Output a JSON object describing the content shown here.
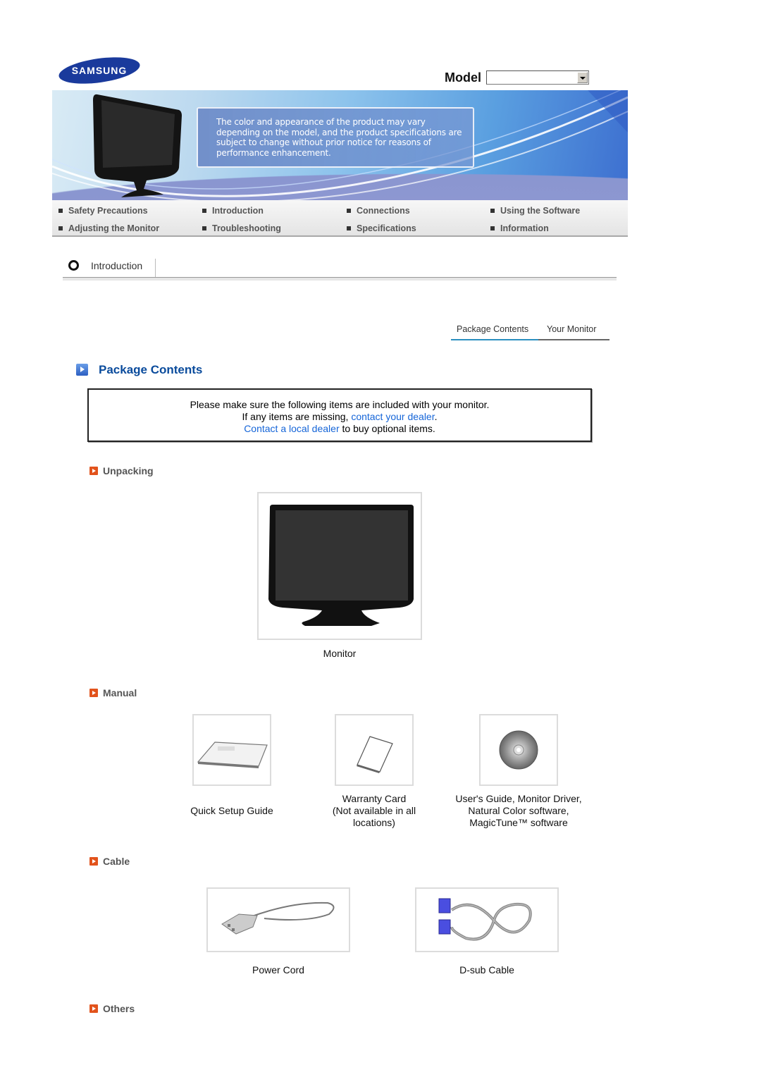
{
  "header": {
    "brand": "SAMSUNG",
    "model_label": "Model",
    "model_select_value": ""
  },
  "banner": {
    "notice": "The color and appearance of the product may vary depending on the model, and the product specifications are subject to change without prior notice for reasons of performance enhancement."
  },
  "nav": {
    "items": [
      {
        "label": "Safety Precautions"
      },
      {
        "label": "Introduction"
      },
      {
        "label": "Connections"
      },
      {
        "label": "Using the Software"
      },
      {
        "label": "Adjusting the Monitor"
      },
      {
        "label": "Troubleshooting"
      },
      {
        "label": "Specifications"
      },
      {
        "label": "Information"
      }
    ]
  },
  "section": {
    "title": "Introduction"
  },
  "tabs": [
    {
      "label": "Package Contents",
      "active": true
    },
    {
      "label": "Your Monitor",
      "active": false
    }
  ],
  "page": {
    "title": "Package Contents",
    "info": {
      "line1": "Please make sure the following items are included with your monitor.",
      "line2_prefix": "If any items are missing, ",
      "line2_link": "contact your dealer",
      "line2_suffix": ".",
      "line3_link": "Contact a local dealer",
      "line3_suffix": " to buy optional items."
    }
  },
  "categories": {
    "unpacking": {
      "label": "Unpacking",
      "items": [
        {
          "caption": "Monitor"
        }
      ]
    },
    "manual": {
      "label": "Manual",
      "items": [
        {
          "caption": "Quick Setup Guide"
        },
        {
          "caption": "Warranty Card\n(Not available in all\nlocations)"
        },
        {
          "caption": "User's Guide, Monitor Driver,\nNatural Color software,\nMagicTune™ software"
        }
      ]
    },
    "cable": {
      "label": "Cable",
      "items": [
        {
          "caption": "Power Cord"
        },
        {
          "caption": "D-sub Cable"
        }
      ]
    },
    "others": {
      "label": "Others"
    }
  },
  "colors": {
    "title_blue": "#0a4b9c",
    "link_blue": "#1565d8",
    "category_orange": "#e2531c",
    "tab_active": "#2a8fc0"
  }
}
